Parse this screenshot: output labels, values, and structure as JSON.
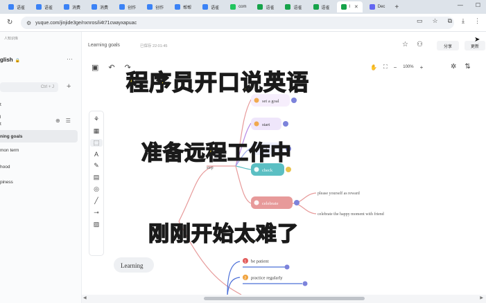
{
  "browser": {
    "tabs": [
      {
        "label": "语雀",
        "color": "#3b82f6"
      },
      {
        "label": "语雀",
        "color": "#3b82f6"
      },
      {
        "label": "消费",
        "color": "#3b82f6"
      },
      {
        "label": "消费",
        "color": "#3b82f6"
      },
      {
        "label": "创作",
        "color": "#3b82f6"
      },
      {
        "label": "创作",
        "color": "#3b82f6"
      },
      {
        "label": "帮帮",
        "color": "#3b82f6"
      },
      {
        "label": "语雀",
        "color": "#3b82f6"
      },
      {
        "label": "com",
        "color": "#22c55e"
      },
      {
        "label": "语雀",
        "color": "#16a34a"
      },
      {
        "label": "语雀",
        "color": "#16a34a"
      },
      {
        "label": "语雀",
        "color": "#16a34a"
      },
      {
        "label": "l",
        "color": "#16a34a",
        "active": true
      },
      {
        "label": "Dec",
        "color": "#6366f1"
      }
    ],
    "new_tab": "+",
    "url": "yuque.com/jinjide3ge/nxnros/ii4t71cwayxapuac"
  },
  "sidebar": {
    "kb_label": "人知识库",
    "title": "glish",
    "search_shortcut": "Ctrl + J",
    "items": [
      {
        "label": "t",
        "active": false
      },
      {
        "label": "l",
        "active": false
      },
      {
        "label": "t",
        "active": false
      },
      {
        "label": "ning goals",
        "active": true
      },
      {
        "label": "mon term",
        "active": false
      },
      {
        "label": "hood",
        "active": false
      },
      {
        "label": "piness",
        "active": false
      }
    ]
  },
  "doc": {
    "title": "Learning goals",
    "saved": "已保存 22:01:45",
    "share_label": "分享",
    "update_label": "更新",
    "zoom": "100%"
  },
  "mindmap": {
    "root": "Learning",
    "branch_step": "step",
    "nodes": [
      {
        "label": "set a goal",
        "color": "#f6eefc",
        "text_color": "#444",
        "badge": 1
      },
      {
        "label": "start",
        "color": "#efe6fb",
        "text_color": "#333",
        "badge": 2
      },
      {
        "label": "act",
        "color": "#eef1ff",
        "text_color": "#333",
        "badge": 3
      },
      {
        "label": "check",
        "color": "#5bbfc3",
        "text_color": "#ffffff",
        "badge": 4
      },
      {
        "label": "celebrate",
        "color": "#e79a9a",
        "text_color": "#ffffff",
        "badge": 5
      }
    ],
    "leaves": [
      "please yourself  as reward",
      "celebrate the happy moment with friend"
    ],
    "bottom": [
      {
        "label": "be patient",
        "badge": "1",
        "badge_color": "#e25b5b"
      },
      {
        "label": "practice regularly",
        "badge": "2",
        "badge_color": "#f0a23c"
      }
    ]
  },
  "overlay": {
    "line1": "程序员开口说英语",
    "line2": "准备远程工作中",
    "line3": "刚刚开始太难了"
  }
}
